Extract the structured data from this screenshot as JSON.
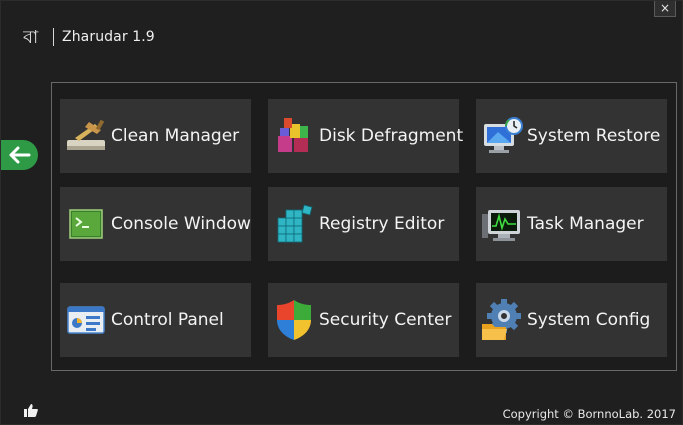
{
  "window": {
    "close_label": "×"
  },
  "header": {
    "logo_text": "বা",
    "title": "Zharudar 1.9"
  },
  "tiles": [
    {
      "label": "Clean Manager"
    },
    {
      "label": "Disk Defragment"
    },
    {
      "label": "System Restore"
    },
    {
      "label": "Console Window"
    },
    {
      "label": "Registry Editor"
    },
    {
      "label": "Task Manager"
    },
    {
      "label": "Control Panel"
    },
    {
      "label": "Security Center"
    },
    {
      "label": "System Config"
    }
  ],
  "footer": {
    "copyright": "Copyright © BornnoLab. 2017"
  },
  "colors": {
    "background": "#1f1f1f",
    "tile": "#333333",
    "accent": "#2e9a45",
    "panel_border": "#686868"
  },
  "icons": {
    "back": "arrow-left-icon",
    "like": "thumbs-up-icon",
    "tiles": [
      "broom-icon",
      "defrag-icon",
      "restore-icon",
      "console-icon",
      "registry-icon",
      "task-manager-icon",
      "control-panel-icon",
      "shield-icon",
      "gear-folder-icon"
    ]
  }
}
